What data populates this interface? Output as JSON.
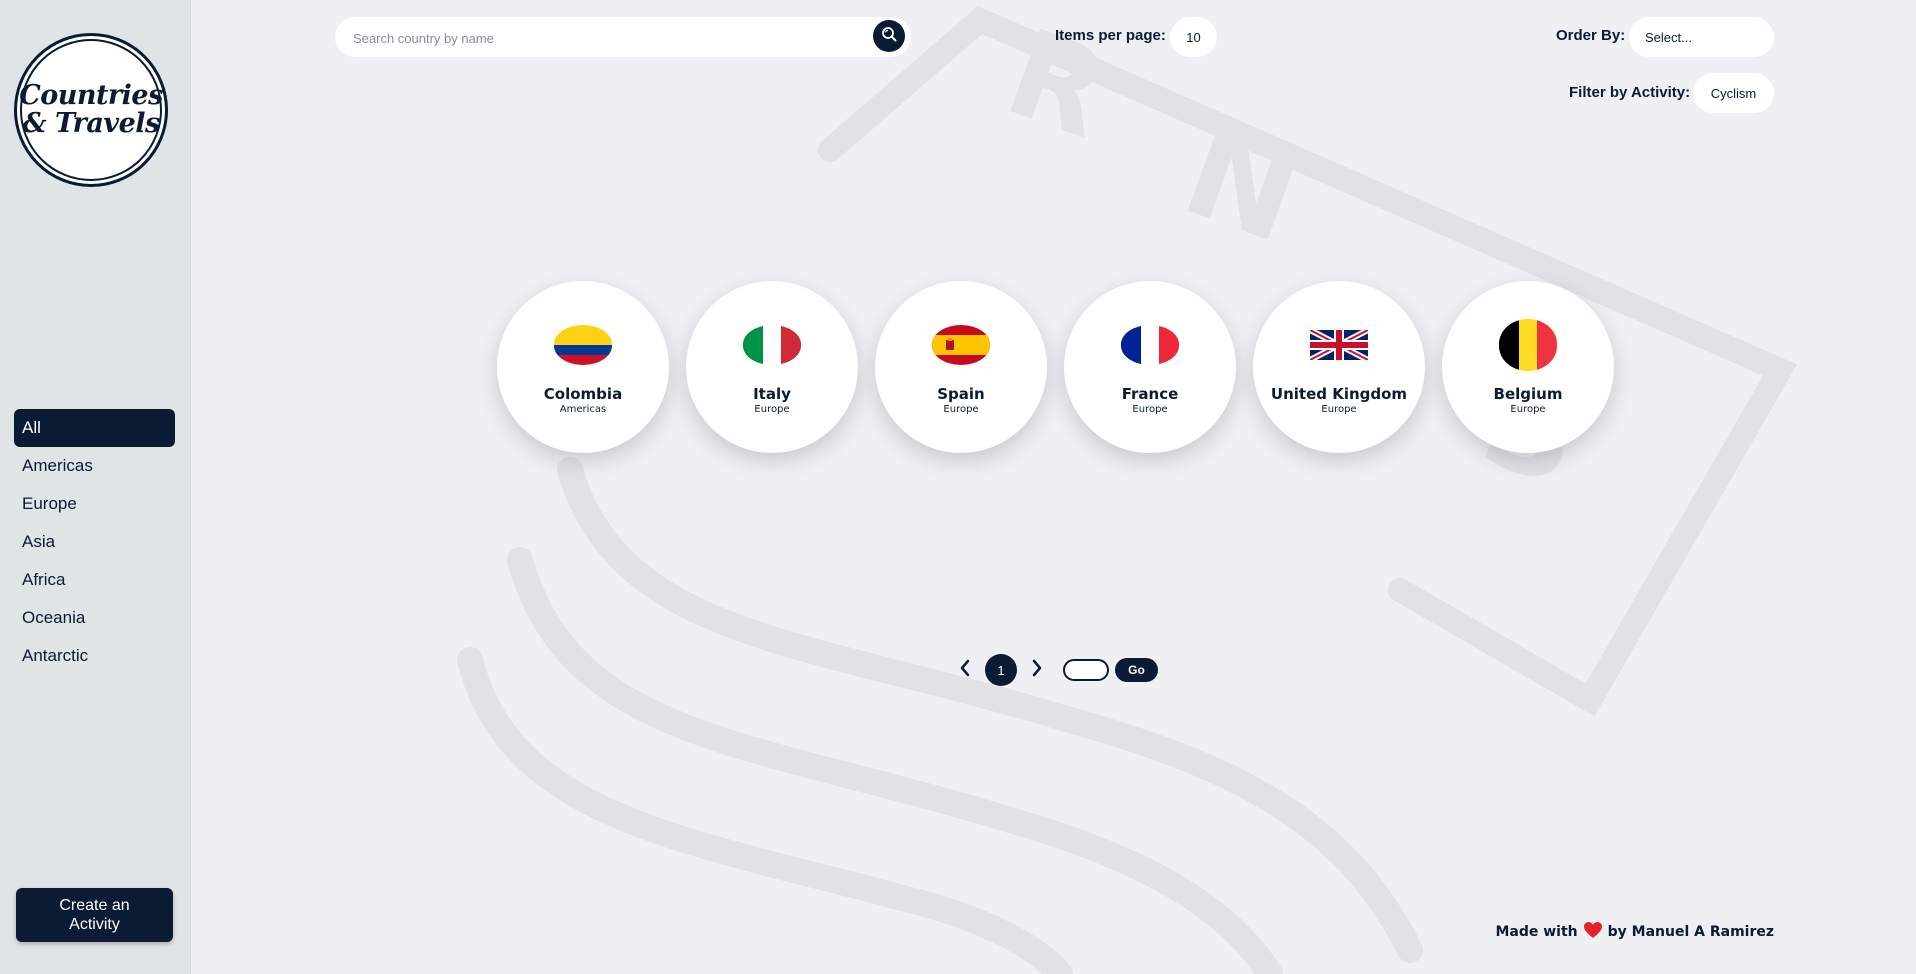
{
  "logo": {
    "text": "Countries\n& Travels"
  },
  "sidebar": {
    "items": [
      {
        "label": "All",
        "active": true
      },
      {
        "label": "Americas"
      },
      {
        "label": "Europe"
      },
      {
        "label": "Asia"
      },
      {
        "label": "Africa"
      },
      {
        "label": "Oceania"
      },
      {
        "label": "Antarctic"
      }
    ],
    "create_button": "Create an\nActivity"
  },
  "search": {
    "placeholder": "Search country by name",
    "icon": "search-icon"
  },
  "items_per_page": {
    "label": "Items per page:",
    "value": "10"
  },
  "order_by": {
    "label": "Order By:",
    "value": "Select..."
  },
  "filter_activity": {
    "label": "Filter by Activity:",
    "value": "Cyclism"
  },
  "countries": [
    {
      "name": "Colombia",
      "region": "Americas",
      "flag": "flag-colombia"
    },
    {
      "name": "Italy",
      "region": "Europe",
      "flag": "flag-italy"
    },
    {
      "name": "Spain",
      "region": "Europe",
      "flag": "flag-spain"
    },
    {
      "name": "France",
      "region": "Europe",
      "flag": "flag-france"
    },
    {
      "name": "United Kingdom",
      "region": "Europe",
      "flag": "flag-uk"
    },
    {
      "name": "Belgium",
      "region": "Europe",
      "flag": "flag-belgium"
    }
  ],
  "pagination": {
    "current_page": "1",
    "go_label": "Go"
  },
  "footer": {
    "prefix": "Made with",
    "suffix": "by Manuel A Ramirez"
  },
  "colors": {
    "primary": "#0b1b33",
    "background": "#eff0f3",
    "sidebar": "#dfe4e6"
  }
}
